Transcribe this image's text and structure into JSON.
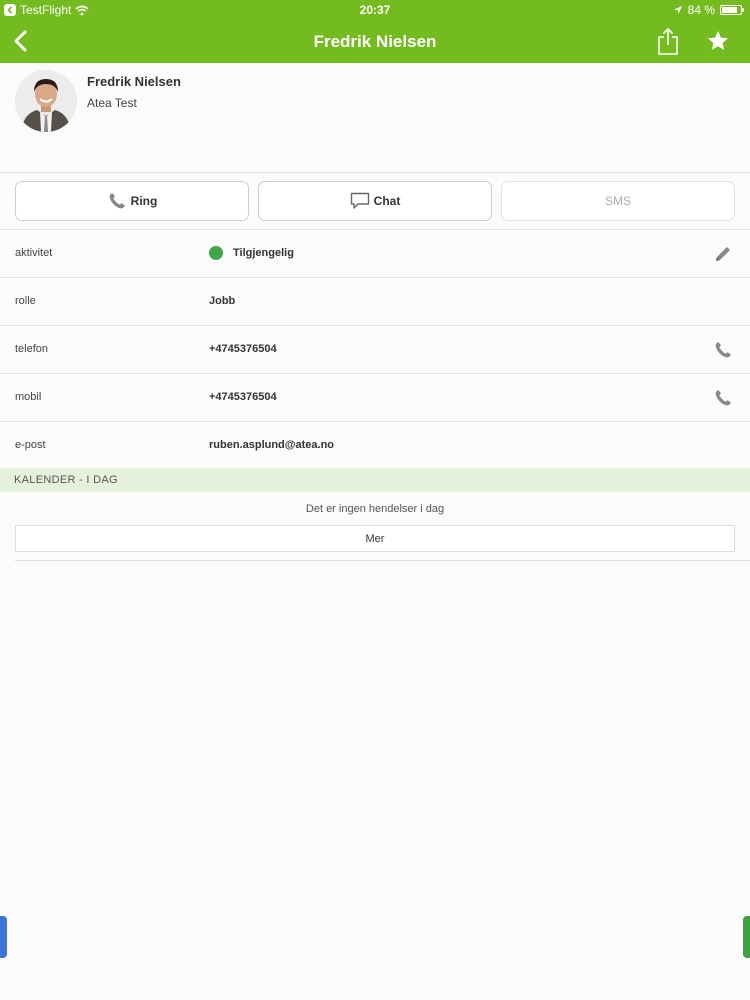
{
  "statusbar": {
    "app": "TestFlight",
    "time": "20:37",
    "battery": "84 %",
    "battery_level": 0.84
  },
  "navbar": {
    "title": "Fredrik Nielsen"
  },
  "profile": {
    "name": "Fredrik Nielsen",
    "company": "Atea Test"
  },
  "actions": {
    "ring": "Ring",
    "chat": "Chat",
    "sms": "SMS"
  },
  "rows": [
    {
      "label": "aktivitet",
      "value": "Tilgjengelig",
      "status_color": "#3fa74a"
    },
    {
      "label": "rolle",
      "value": "Jobb"
    },
    {
      "label": "telefon",
      "value": "+4745376504"
    },
    {
      "label": "mobil",
      "value": "+4745376504"
    },
    {
      "label": "e-post",
      "value": "ruben.asplund@atea.no"
    }
  ],
  "calendar": {
    "header": "KALENDER - I DAG",
    "empty_text": "Det er ingen hendelser i dag",
    "more_button": "Mer"
  },
  "colors": {
    "brand": "#74bb1f",
    "calendar_header_bg": "#e5f1dc",
    "available": "#3fa74a"
  }
}
